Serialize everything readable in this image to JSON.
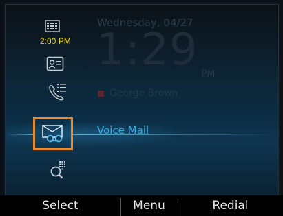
{
  "home": {
    "date": "Wednesday, 04/27",
    "time": "1:29",
    "ampm": "PM",
    "presence_name": "George Brown",
    "calendar_time": "2:00 PM",
    "selected_item": "Voice Mail",
    "selected_icon": "voicemail-icon",
    "highlight_color": "#f08a27",
    "accent_color": "#3aaee6"
  },
  "softkeys": {
    "left": "Select",
    "middle": "Menu",
    "right": "Redial"
  }
}
